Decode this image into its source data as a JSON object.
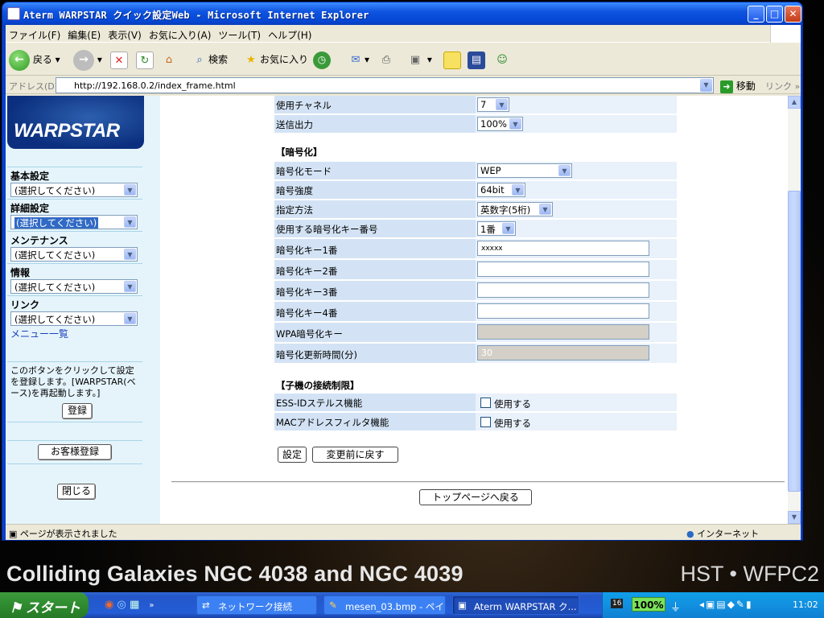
{
  "window": {
    "title": "Aterm WARPSTAR クイック設定Web - Microsoft Internet Explorer"
  },
  "menu": [
    "ファイル(F)",
    "編集(E)",
    "表示(V)",
    "お気に入り(A)",
    "ツール(T)",
    "ヘルプ(H)"
  ],
  "toolbar": {
    "back": "戻る",
    "search": "検索",
    "favorites": "お気に入り"
  },
  "address": {
    "label": "アドレス(D)",
    "url": "http://192.168.0.2/index_frame.html",
    "go": "移動",
    "links": "リンク"
  },
  "sidebar": {
    "logo": "WARPSTAR",
    "groups": [
      {
        "heading": "基本設定",
        "value": "(選択してください)"
      },
      {
        "heading": "詳細設定",
        "value": "(選択してください)"
      },
      {
        "heading": "メンテナンス",
        "value": "(選択してください)"
      },
      {
        "heading": "情報",
        "value": "(選択してください)"
      },
      {
        "heading": "リンク",
        "value": "(選択してください)"
      }
    ],
    "menu_all": "メニュー一覧",
    "info_text": "このボタンをクリックして設定を登録します。[WARPSTAR(ベース)を再起動します。]",
    "register_btn": "登録",
    "customer_btn": "お客様登録",
    "close_btn": "閉じる"
  },
  "form": {
    "channel": {
      "label": "使用チャネル",
      "value": "7"
    },
    "tx_power": {
      "label": "送信出力",
      "value": "100%"
    },
    "enc_section": "【暗号化】",
    "enc_mode": {
      "label": "暗号化モード",
      "value": "WEP"
    },
    "enc_strength": {
      "label": "暗号強度",
      "value": "64bit"
    },
    "spec_method": {
      "label": "指定方法",
      "value": "英数字(5桁)"
    },
    "key_no": {
      "label": "使用する暗号化キー番号",
      "value": "1番"
    },
    "key1": {
      "label": "暗号化キー1番",
      "value": "xxxxx"
    },
    "key2": {
      "label": "暗号化キー2番",
      "value": ""
    },
    "key3": {
      "label": "暗号化キー3番",
      "value": ""
    },
    "key4": {
      "label": "暗号化キー4番",
      "value": ""
    },
    "wpa_key": {
      "label": "WPA暗号化キー",
      "value": ""
    },
    "rekey": {
      "label": "暗号化更新時間(分)",
      "value": "30"
    },
    "child_section": "【子機の接続制限】",
    "ess_stealth": {
      "label": "ESS-IDステルス機能",
      "check": "使用する"
    },
    "mac_filter": {
      "label": "MACアドレスフィルタ機能",
      "check": "使用する"
    },
    "set_btn": "設定",
    "revert_btn": "変更前に戻す",
    "top_btn": "トップページへ戻る"
  },
  "status": {
    "left": "ページが表示されました",
    "zone": "インターネット"
  },
  "wallpaper": {
    "caption": "Colliding Galaxies NGC 4038 and NGC 4039",
    "credit": "HST • WFPC2"
  },
  "taskbar": {
    "start": "スタート",
    "tasks": [
      "ネットワーク接続",
      "mesen_03.bmp - ペイ...",
      "Aterm WARPSTAR ク..."
    ],
    "battery": "100%",
    "clock": "11:02",
    "tray_num": "16"
  }
}
